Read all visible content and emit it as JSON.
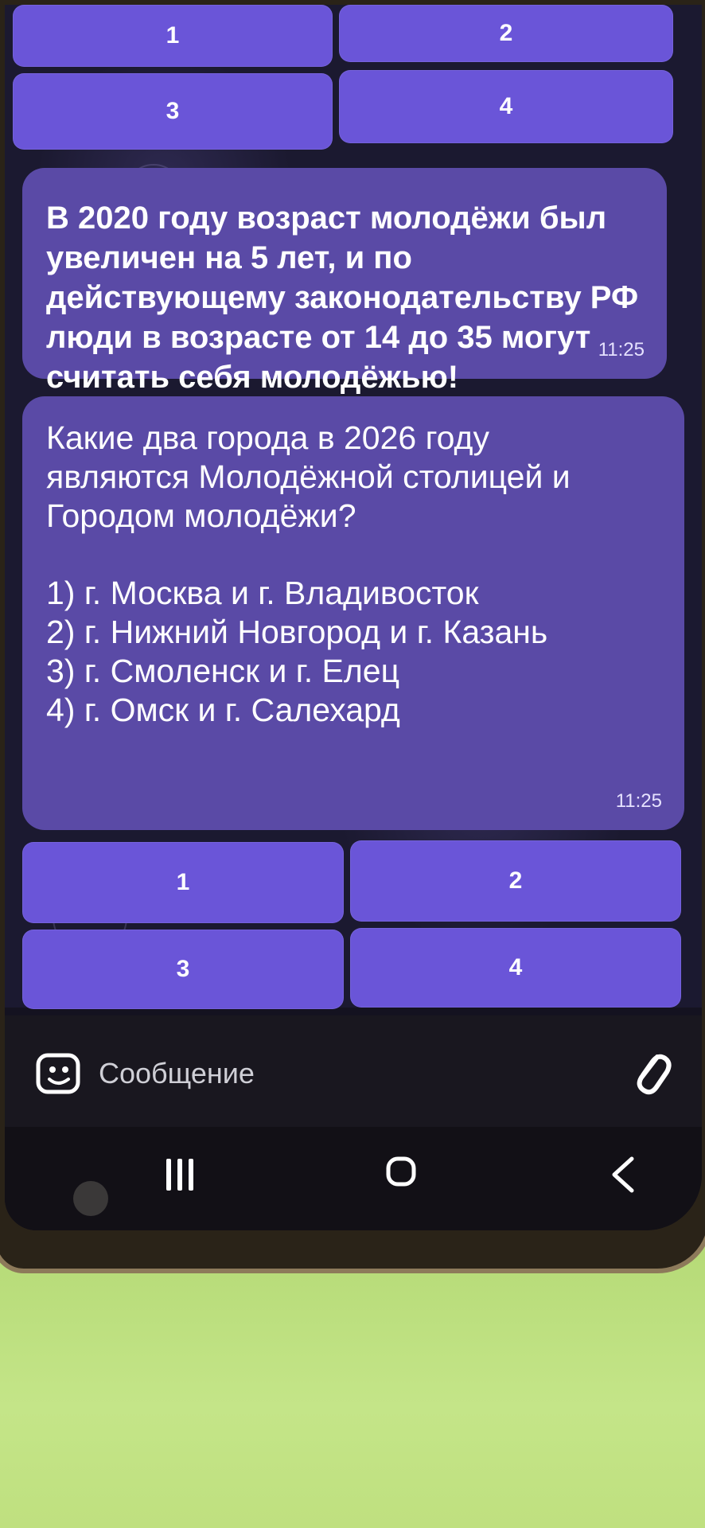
{
  "keyboard_top": {
    "buttons": [
      "1",
      "2",
      "3",
      "4"
    ]
  },
  "message_info": {
    "text": "В 2020 году возраст молодёжи был\nувеличен на 5 лет, и по\nдействующему законодательству РФ\nлюди в возрасте от 14 до 35 могут\nсчитать себя молодёжью!",
    "time": "11:25"
  },
  "message_question": {
    "question": "Какие два города в 2026 году\nявляются Молодёжной столицей и\nГородом молодёжи?",
    "options": [
      "1) г. Москва и г. Владивосток",
      "2) г. Нижний Новгород и г. Казань",
      "3) г. Смоленск и г. Елец",
      "4) г. Омск и г. Салехард"
    ],
    "time": "11:25"
  },
  "keyboard_bottom": {
    "buttons": [
      "1",
      "2",
      "3",
      "4"
    ]
  },
  "input": {
    "placeholder": "Сообщение",
    "emoji_icon": "sticker-emoji-icon",
    "attach_icon": "paperclip-icon"
  },
  "navigation": {
    "recents_icon": "recents-icon",
    "home_icon": "home-icon",
    "back_icon": "back-icon"
  },
  "colors": {
    "button": "#6a55d8",
    "bubble": "#5a4aa6",
    "background": "#1b1930"
  }
}
